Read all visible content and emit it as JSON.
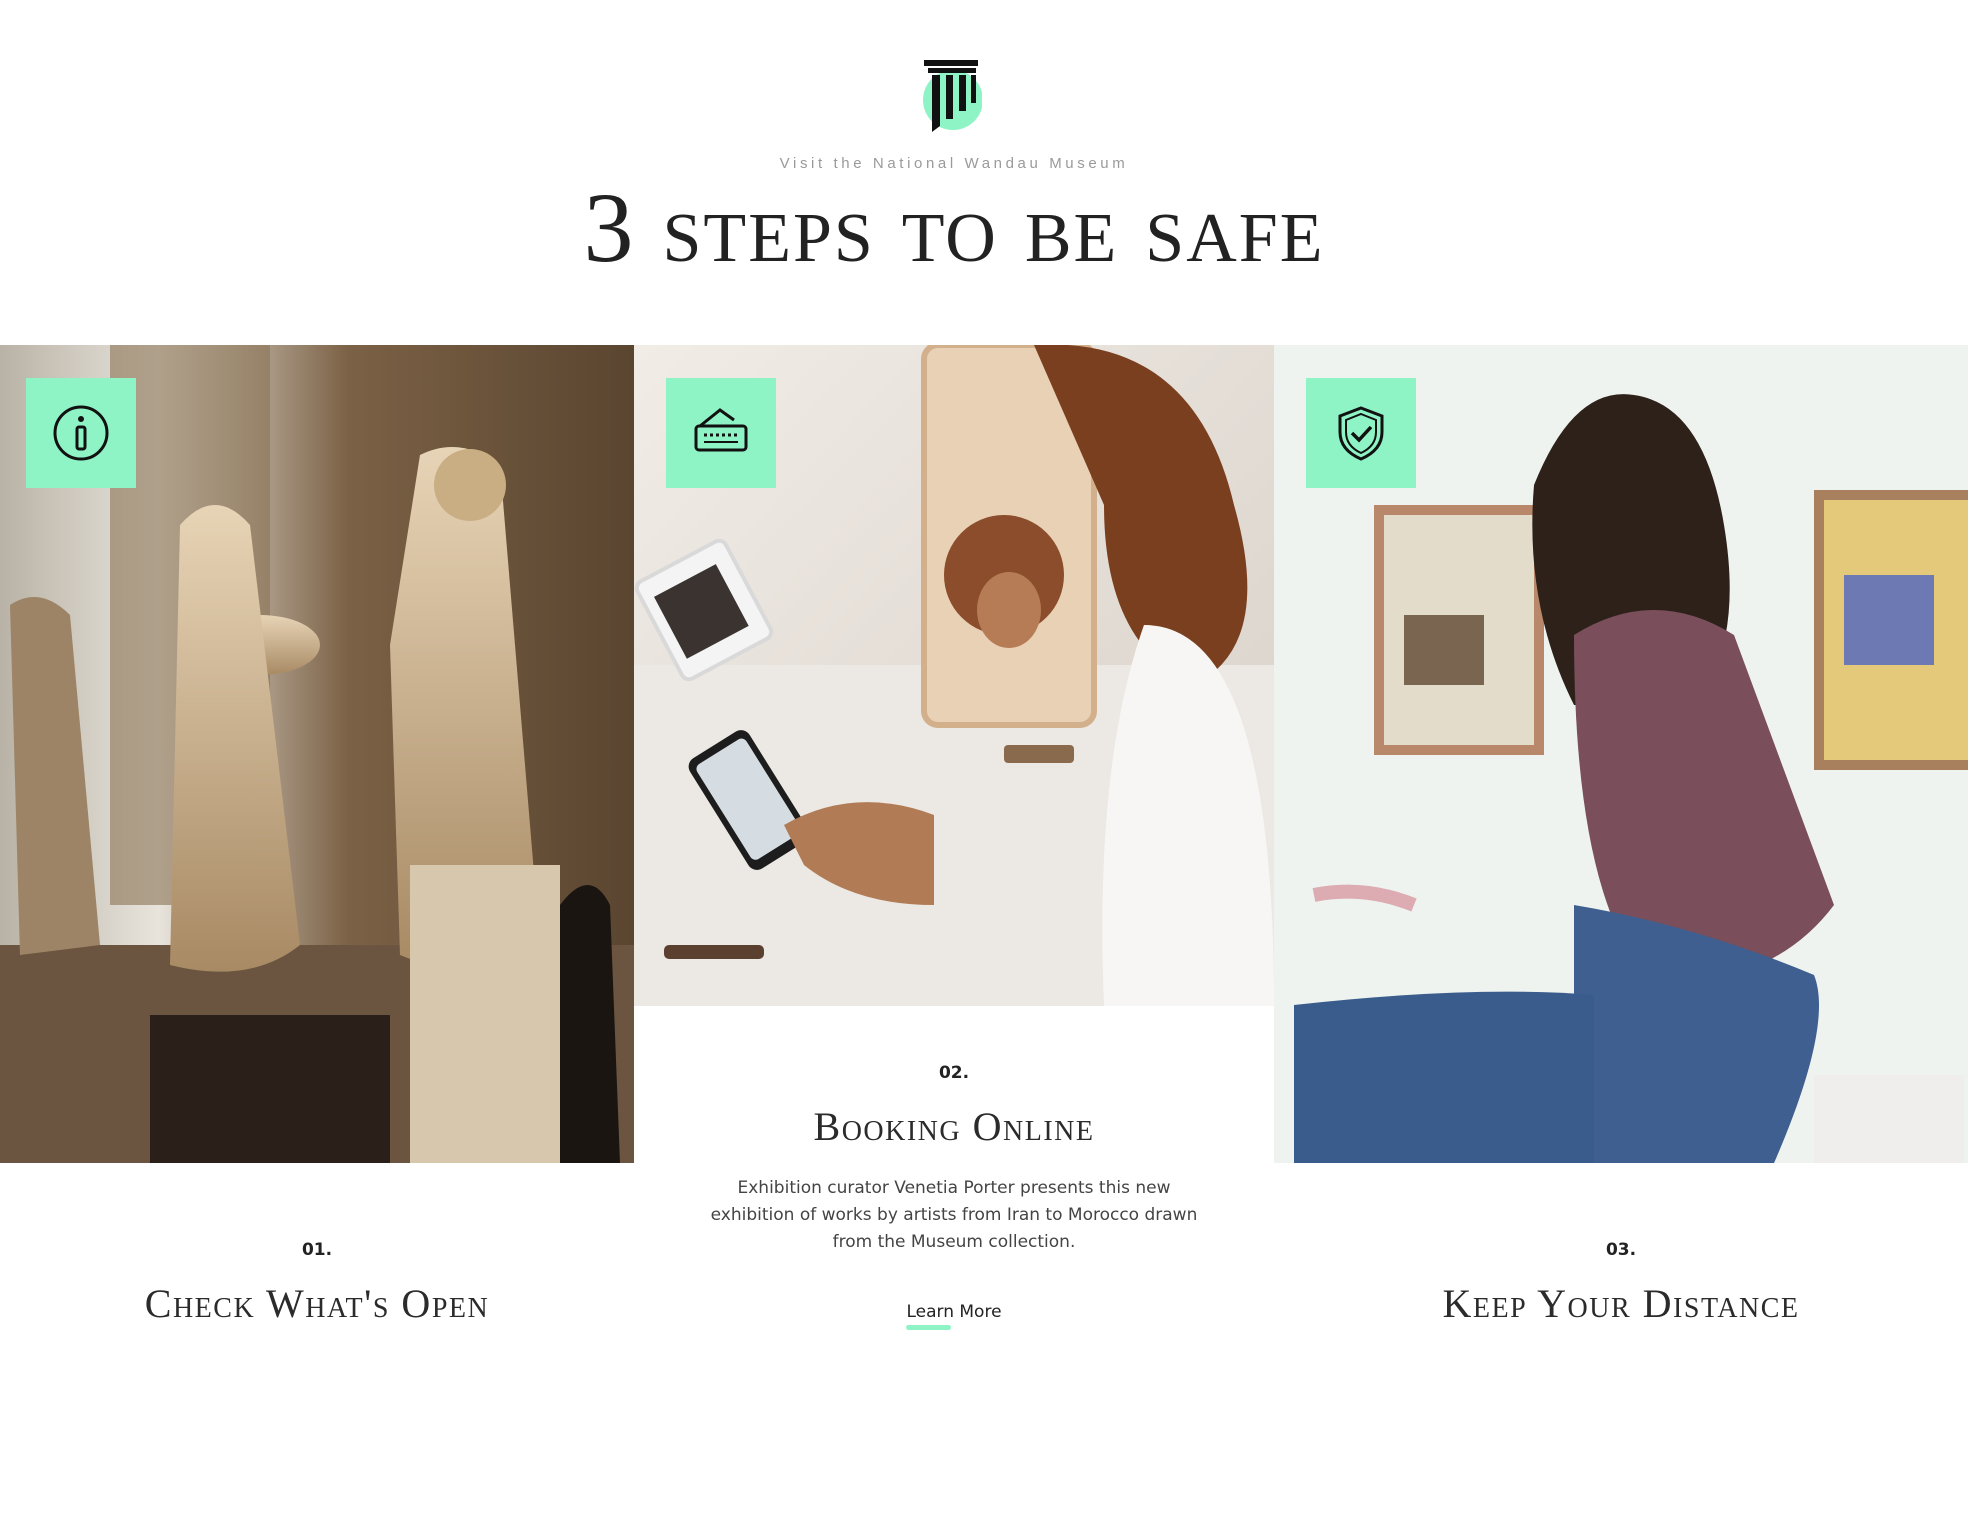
{
  "header": {
    "logo_icon": "museum-column-icon",
    "eyebrow": "Visit the National Wandau Museum",
    "title": "3 steps to be safe"
  },
  "accent_color": "#8ef3c5",
  "steps": [
    {
      "icon": "info-icon",
      "number": "01.",
      "title": "Check What's Open"
    },
    {
      "icon": "ticket-icon",
      "number": "02.",
      "title": "Booking Online",
      "description": "Exhibition curator Venetia Porter presents this new exhibition of works by artists from Iran to Morocco drawn from the Museum collection.",
      "link": "Learn More"
    },
    {
      "icon": "shield-check-icon",
      "number": "03.",
      "title": "Keep Your Distance"
    }
  ]
}
